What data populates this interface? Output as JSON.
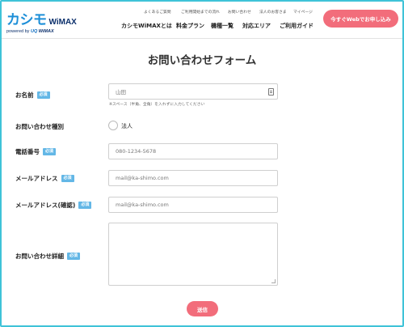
{
  "header": {
    "logo": {
      "brand": "カシモ",
      "product": "WiMAX",
      "powered_prefix": "powered by ",
      "powered_brand": "UQ",
      "powered_suffix": " WiMAX"
    },
    "util_nav": [
      "よくあるご質問",
      "ご利用開始までの流れ",
      "お問い合わせ",
      "法人のお客さま",
      "マイページ"
    ],
    "main_nav": [
      "カシモWiMAXとは",
      "料金プラン",
      "機種一覧",
      "対応エリア",
      "ご利用ガイド"
    ],
    "cta_label": "今すぐWebでお申し込み"
  },
  "form": {
    "title": "お問い合わせフォーム",
    "required_badge": "必須",
    "name": {
      "label": "お名前",
      "placeholder": "山田",
      "hint": "※スペース（半角、全角）を入れずに入力してください"
    },
    "inquiry_type": {
      "label": "お問い合わせ種別",
      "option": "法人"
    },
    "phone": {
      "label": "電話番号",
      "placeholder": "080-1234-5678"
    },
    "email": {
      "label": "メールアドレス",
      "placeholder": "mail@ka-shimo.com"
    },
    "email_confirm": {
      "label": "メールアドレス(確認)",
      "placeholder": "mail@ka-shimo.com"
    },
    "details": {
      "label": "お問い合わせ詳細"
    },
    "submit_label": "送信"
  },
  "colors": {
    "accent_pink": "#f26d7b",
    "badge_blue": "#63b7e6",
    "logo_blue": "#1d8fd8",
    "frame_cyan": "#3fc3d8"
  }
}
